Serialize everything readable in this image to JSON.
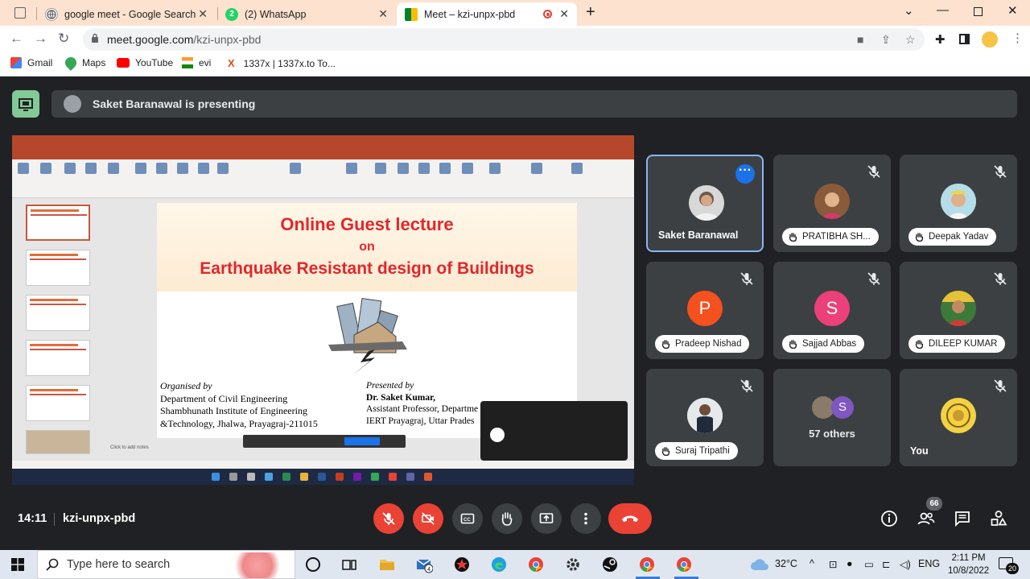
{
  "browser": {
    "tabs": [
      {
        "label": "google meet - Google Search"
      },
      {
        "label": "(2) WhatsApp"
      },
      {
        "label": "Meet – kzi-unpx-pbd"
      }
    ],
    "url_host": "meet.google.com",
    "url_path": "/kzi-unpx-pbd",
    "bookmarks": [
      {
        "label": "Gmail"
      },
      {
        "label": "Maps"
      },
      {
        "label": "YouTube"
      },
      {
        "label": "evi"
      },
      {
        "label": "1337x | 1337x.to To..."
      }
    ]
  },
  "meet": {
    "presenting_banner": "Saket Baranawal is presenting",
    "slide": {
      "line1": "Online Guest lecture",
      "line2": "on",
      "line3": "Earthquake Resistant design of Buildings",
      "organised_heading": "Organised by",
      "organised_lines": [
        "Department of Civil Engineering",
        "Shambhunath Institute of Engineering",
        "&Technology, Jhalwa, Prayagraj-211015"
      ],
      "presented_heading": "Presented by",
      "presenter_name": "Dr. Saket Kumar,",
      "presenter_lines": [
        "Assistant Professor, Departme",
        "IERT Prayagraj, Uttar Prades"
      ],
      "notes_placeholder": "Click to add notes"
    },
    "participants": [
      {
        "name": "Saket Baranawal",
        "style": "plain"
      },
      {
        "name": "PRATIBHA SH...",
        "style": "pill"
      },
      {
        "name": "Deepak Yadav",
        "style": "pill"
      },
      {
        "name": "Pradeep Nishad",
        "style": "pill",
        "initial": "P",
        "color": "#f4511e"
      },
      {
        "name": "Sajjad Abbas",
        "style": "pill",
        "initial": "S",
        "color": "#ec407a"
      },
      {
        "name": "DILEEP KUMAR",
        "style": "pill"
      },
      {
        "name": "Suraj Tripathi",
        "style": "pill"
      },
      {
        "name": "57 others",
        "style": "others",
        "initial": "S"
      },
      {
        "name": "You",
        "style": "plain"
      }
    ],
    "meeting_time": "14:11",
    "meeting_code": "kzi-unpx-pbd",
    "participant_count": "66"
  },
  "taskbar": {
    "search_placeholder": "Type here to search",
    "mail_badge": "4",
    "temperature": "32°C",
    "language": "ENG",
    "time": "2:11 PM",
    "date": "10/8/2022",
    "notifications": "20"
  },
  "colors": {
    "meet_bg": "#202124",
    "tile_bg": "#3c4043",
    "danger": "#ea4335",
    "highlight": "#8ab4f8"
  }
}
